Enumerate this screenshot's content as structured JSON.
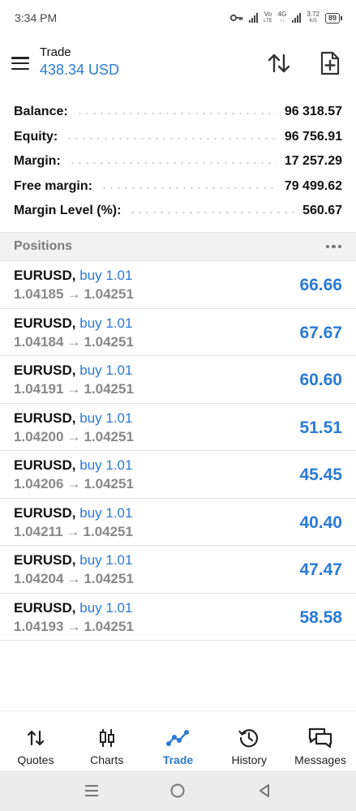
{
  "status_bar": {
    "time": "3:34 PM",
    "network_label": "Vo LTE",
    "network_gen": "4G",
    "speed_value": "3.72",
    "speed_unit": "K/S",
    "battery": "89"
  },
  "header": {
    "title": "Trade",
    "subtitle": "438.34 USD"
  },
  "summary": [
    {
      "label": "Balance:",
      "value": "96 318.57"
    },
    {
      "label": "Equity:",
      "value": "96 756.91"
    },
    {
      "label": "Margin:",
      "value": "17 257.29"
    },
    {
      "label": "Free margin:",
      "value": "79 499.62"
    },
    {
      "label": "Margin Level (%):",
      "value": "560.67"
    }
  ],
  "positions": {
    "title": "Positions",
    "arrow_glyph": "→",
    "items": [
      {
        "symbol": "EURUSD,",
        "side": "buy 1.01",
        "open": "1.04185",
        "current": "1.04251",
        "profit": "66.66"
      },
      {
        "symbol": "EURUSD,",
        "side": "buy 1.01",
        "open": "1.04184",
        "current": "1.04251",
        "profit": "67.67"
      },
      {
        "symbol": "EURUSD,",
        "side": "buy 1.01",
        "open": "1.04191",
        "current": "1.04251",
        "profit": "60.60"
      },
      {
        "symbol": "EURUSD,",
        "side": "buy 1.01",
        "open": "1.04200",
        "current": "1.04251",
        "profit": "51.51"
      },
      {
        "symbol": "EURUSD,",
        "side": "buy 1.01",
        "open": "1.04206",
        "current": "1.04251",
        "profit": "45.45"
      },
      {
        "symbol": "EURUSD,",
        "side": "buy 1.01",
        "open": "1.04211",
        "current": "1.04251",
        "profit": "40.40"
      },
      {
        "symbol": "EURUSD,",
        "side": "buy 1.01",
        "open": "1.04204",
        "current": "1.04251",
        "profit": "47.47"
      },
      {
        "symbol": "EURUSD,",
        "side": "buy 1.01",
        "open": "1.04193",
        "current": "1.04251",
        "profit": "58.58"
      }
    ]
  },
  "bottom_nav": [
    {
      "label": "Quotes",
      "icon": "quotes-icon"
    },
    {
      "label": "Charts",
      "icon": "charts-icon"
    },
    {
      "label": "Trade",
      "icon": "trade-icon",
      "active": true
    },
    {
      "label": "History",
      "icon": "history-icon"
    },
    {
      "label": "Messages",
      "icon": "messages-icon"
    }
  ],
  "colors": {
    "accent": "#2a7ad6",
    "muted_text": "#888888",
    "section_bg": "#f2f2f2"
  }
}
